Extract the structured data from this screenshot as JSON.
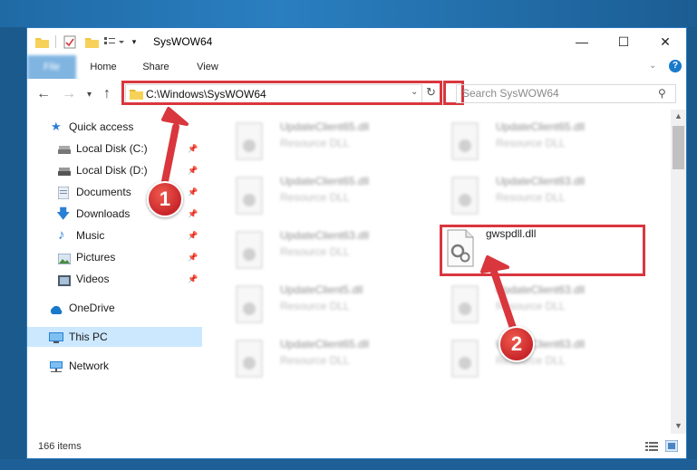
{
  "window": {
    "title": "SysWOW64",
    "minimize_glyph": "—",
    "maximize_glyph": "☐",
    "close_glyph": "✕"
  },
  "ribbon": {
    "tabs": [
      "File",
      "Home",
      "Share",
      "View"
    ]
  },
  "address": {
    "path": "C:\\Windows\\SysWOW64",
    "search_placeholder": "Search SysWOW64"
  },
  "sidebar": {
    "items": [
      {
        "label": "Quick access",
        "icon": "star-icon"
      },
      {
        "label": "Local Disk (C:)",
        "icon": "drive-icon",
        "pinned": true
      },
      {
        "label": "Local Disk (D:)",
        "icon": "drive-icon",
        "pinned": true
      },
      {
        "label": "Documents",
        "icon": "documents-icon",
        "pinned": true
      },
      {
        "label": "Downloads",
        "icon": "download-icon",
        "pinned": true
      },
      {
        "label": "Music",
        "icon": "music-icon",
        "pinned": true
      },
      {
        "label": "Pictures",
        "icon": "pictures-icon",
        "pinned": true
      },
      {
        "label": "Videos",
        "icon": "videos-icon",
        "pinned": true
      },
      {
        "label": "OneDrive",
        "icon": "cloud-icon"
      },
      {
        "label": "This PC",
        "icon": "computer-icon",
        "selected": true
      },
      {
        "label": "Network",
        "icon": "network-icon"
      }
    ]
  },
  "files": [
    {
      "name": "UpdateClient65.dll",
      "type": "Resource DLL"
    },
    {
      "name": "UpdateClient65.dll",
      "type": "Resource DLL"
    },
    {
      "name": "UpdateClient65.dll",
      "type": "Resource DLL"
    },
    {
      "name": "UpdateClient63.dll",
      "type": "Resource DLL"
    },
    {
      "name": "UpdateClient63.dll",
      "type": "Resource DLL"
    },
    {
      "name": "UpdateClient5.dll",
      "type": "Resource DLL"
    },
    {
      "name": "UpdateClient63.dll",
      "type": "Resource DLL"
    },
    {
      "name": "UpdateClient65.dll",
      "type": "Resource DLL"
    },
    {
      "name": "UpdateClient63.dll",
      "type": "Resource DLL"
    }
  ],
  "highlighted_file": {
    "name": "gwspdll.dll"
  },
  "status": {
    "item_count": "166 items"
  },
  "annotations": {
    "step1": "1",
    "step2": "2"
  },
  "colors": {
    "accent": "#1979ca",
    "highlight": "#d9363e",
    "selected": "#cce8ff"
  }
}
